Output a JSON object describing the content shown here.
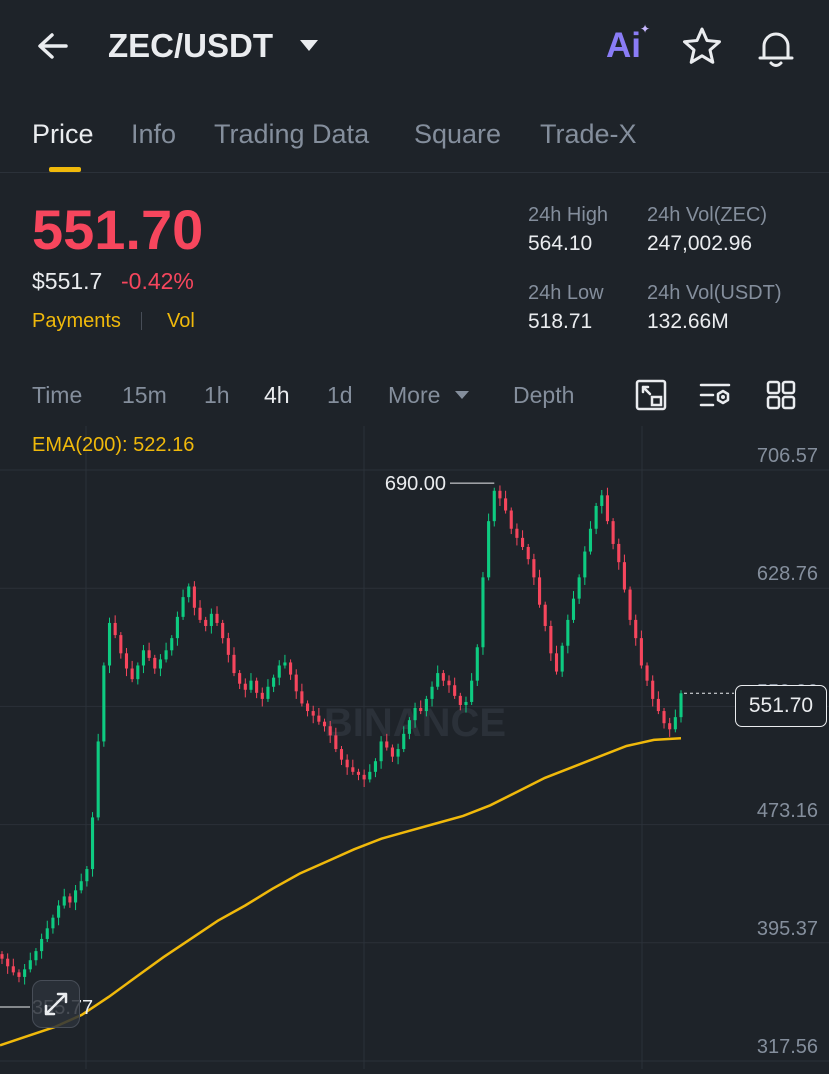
{
  "header": {
    "back_icon": "arrow-left-icon",
    "pair": "ZEC/USDT",
    "ai_label": "Ai",
    "star_icon": "star-icon",
    "bell_icon": "bell-icon"
  },
  "tabs": [
    {
      "label": "Price",
      "active": true
    },
    {
      "label": "Info"
    },
    {
      "label": "Trading Data"
    },
    {
      "label": "Square"
    },
    {
      "label": "Trade-X"
    }
  ],
  "price": {
    "last": "551.70",
    "usd": "$551.7",
    "change": "-0.42%",
    "payments": "Payments",
    "vol": "Vol",
    "color_down": "#f6465d",
    "color_up": "#0ecb81",
    "accent": "#f0b90b"
  },
  "stats": {
    "high_label": "24h High",
    "high_value": "564.10",
    "low_label": "24h Low",
    "low_value": "518.71",
    "vol_base_label": "24h Vol(ZEC)",
    "vol_base_value": "247,002.96",
    "vol_quote_label": "24h Vol(USDT)",
    "vol_quote_value": "132.66M"
  },
  "intervals": [
    {
      "label": "Time"
    },
    {
      "label": "15m"
    },
    {
      "label": "1h"
    },
    {
      "label": "4h",
      "active": true
    },
    {
      "label": "1d"
    },
    {
      "label": "More"
    },
    {
      "label": "Depth"
    }
  ],
  "tools": [
    "chart-layout-icon",
    "indicator-settings-icon",
    "grid-view-icon"
  ],
  "chart": {
    "ema_label": "EMA(200): 522.16",
    "y_ticks": [
      "706.57",
      "628.76",
      "550.96",
      "473.16",
      "395.37",
      "317.56"
    ],
    "high_marker": "690.00",
    "low_marker": "355.77",
    "current_price": "551.70",
    "watermark": "BINANCE",
    "expand_icon": "expand-arrows-icon"
  },
  "chart_data": {
    "type": "candlestick",
    "symbol": "ZEC/USDT",
    "interval": "4h",
    "ylim": [
      317.56,
      706.57
    ],
    "y_ticks": [
      706.57,
      628.76,
      550.96,
      473.16,
      395.37,
      317.56
    ],
    "grid": true,
    "annotations": {
      "max": 690.0,
      "min": 355.77,
      "last": 551.7
    },
    "ema200": [
      320,
      326,
      332,
      340,
      352,
      365,
      378,
      390,
      402,
      412,
      423,
      433,
      441,
      449,
      456,
      461,
      466,
      471,
      478,
      487,
      496,
      503,
      510,
      517,
      521,
      522.16
    ],
    "closes": [
      377,
      372,
      368,
      365,
      370,
      376,
      382,
      390,
      397,
      404,
      412,
      418,
      414,
      422,
      428,
      436,
      470,
      520,
      570,
      598,
      590,
      578,
      568,
      561,
      570,
      580,
      575,
      568,
      574,
      580,
      588,
      602,
      615,
      622,
      608,
      600,
      596,
      604,
      598,
      588,
      577,
      565,
      558,
      554,
      560,
      552,
      548,
      556,
      562,
      570,
      572,
      564,
      553,
      545,
      540,
      537,
      533,
      530,
      524,
      515,
      508,
      503,
      500,
      498,
      495,
      500,
      507,
      520,
      516,
      510,
      515,
      525,
      534,
      542,
      540,
      548,
      556,
      565,
      560,
      557,
      550,
      544,
      546,
      560,
      582,
      628,
      665,
      685,
      680,
      672,
      660,
      654,
      648,
      640,
      628,
      610,
      596,
      578,
      566,
      583,
      600,
      614,
      628,
      645,
      660,
      675,
      682,
      665,
      650,
      638,
      620,
      600,
      588,
      570,
      560,
      548,
      540,
      532,
      528,
      536,
      551.7
    ]
  }
}
